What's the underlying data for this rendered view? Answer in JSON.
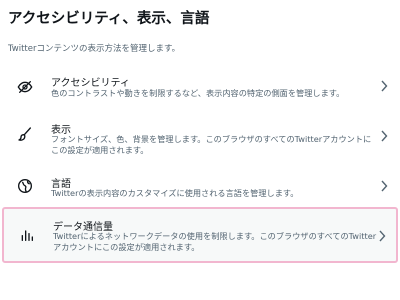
{
  "header": {
    "title": "アクセシビリティ、表示、言語",
    "subtitle": "Twitterコンテンツの表示方法を管理します。"
  },
  "items": [
    {
      "title": "アクセシビリティ",
      "description": "色のコントラストや動きを制限するなど、表示内容の特定の側面を管理します。",
      "icon": "accessibility-icon"
    },
    {
      "title": "表示",
      "description": "フォントサイズ、色、背景を管理します。このブラウザのすべてのTwitterアカウントにこの設定が適用されます。",
      "icon": "brush-icon"
    },
    {
      "title": "言語",
      "description": "Twitterの表示内容のカスタマイズに使用される言語を管理します。",
      "icon": "globe-icon"
    },
    {
      "title": "データ通信量",
      "description": "Twitterによるネットワークデータの使用を制限します。このブラウザのすべてのTwitterアカウントにこの設定が適用されます。",
      "icon": "bar-chart-icon"
    }
  ],
  "colors": {
    "text_primary": "#0f1419",
    "text_secondary": "#536471",
    "highlight_border": "#f2b6cf",
    "highlight_background": "#f7f9f9"
  }
}
